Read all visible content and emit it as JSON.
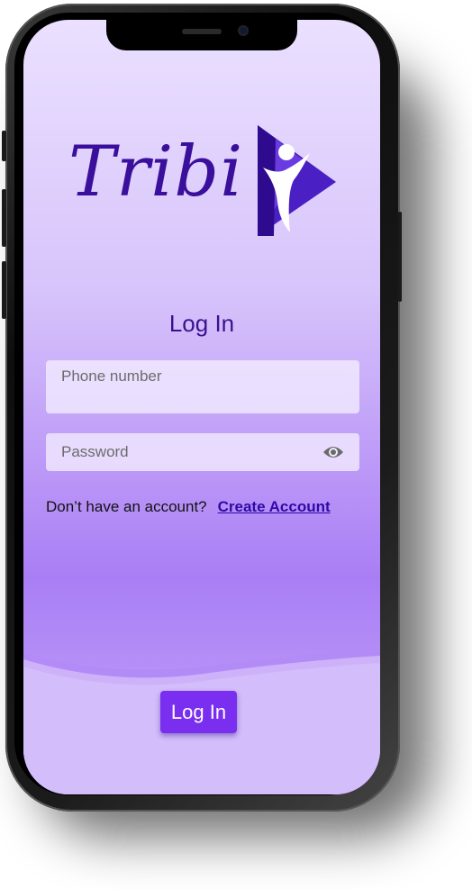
{
  "brand": {
    "name": "Tribi"
  },
  "login": {
    "title": "Log In",
    "phone_placeholder": "Phone number",
    "password_placeholder": "Password",
    "no_account_text": "Don’t have an account?",
    "create_account_label": "Create Account",
    "submit_label": "Log In"
  },
  "icons": {
    "password_toggle": "eye-icon"
  },
  "colors": {
    "brand_purple": "#3a0f9c",
    "accent_button": "#7a2ef0",
    "link": "#2e0aa8"
  }
}
